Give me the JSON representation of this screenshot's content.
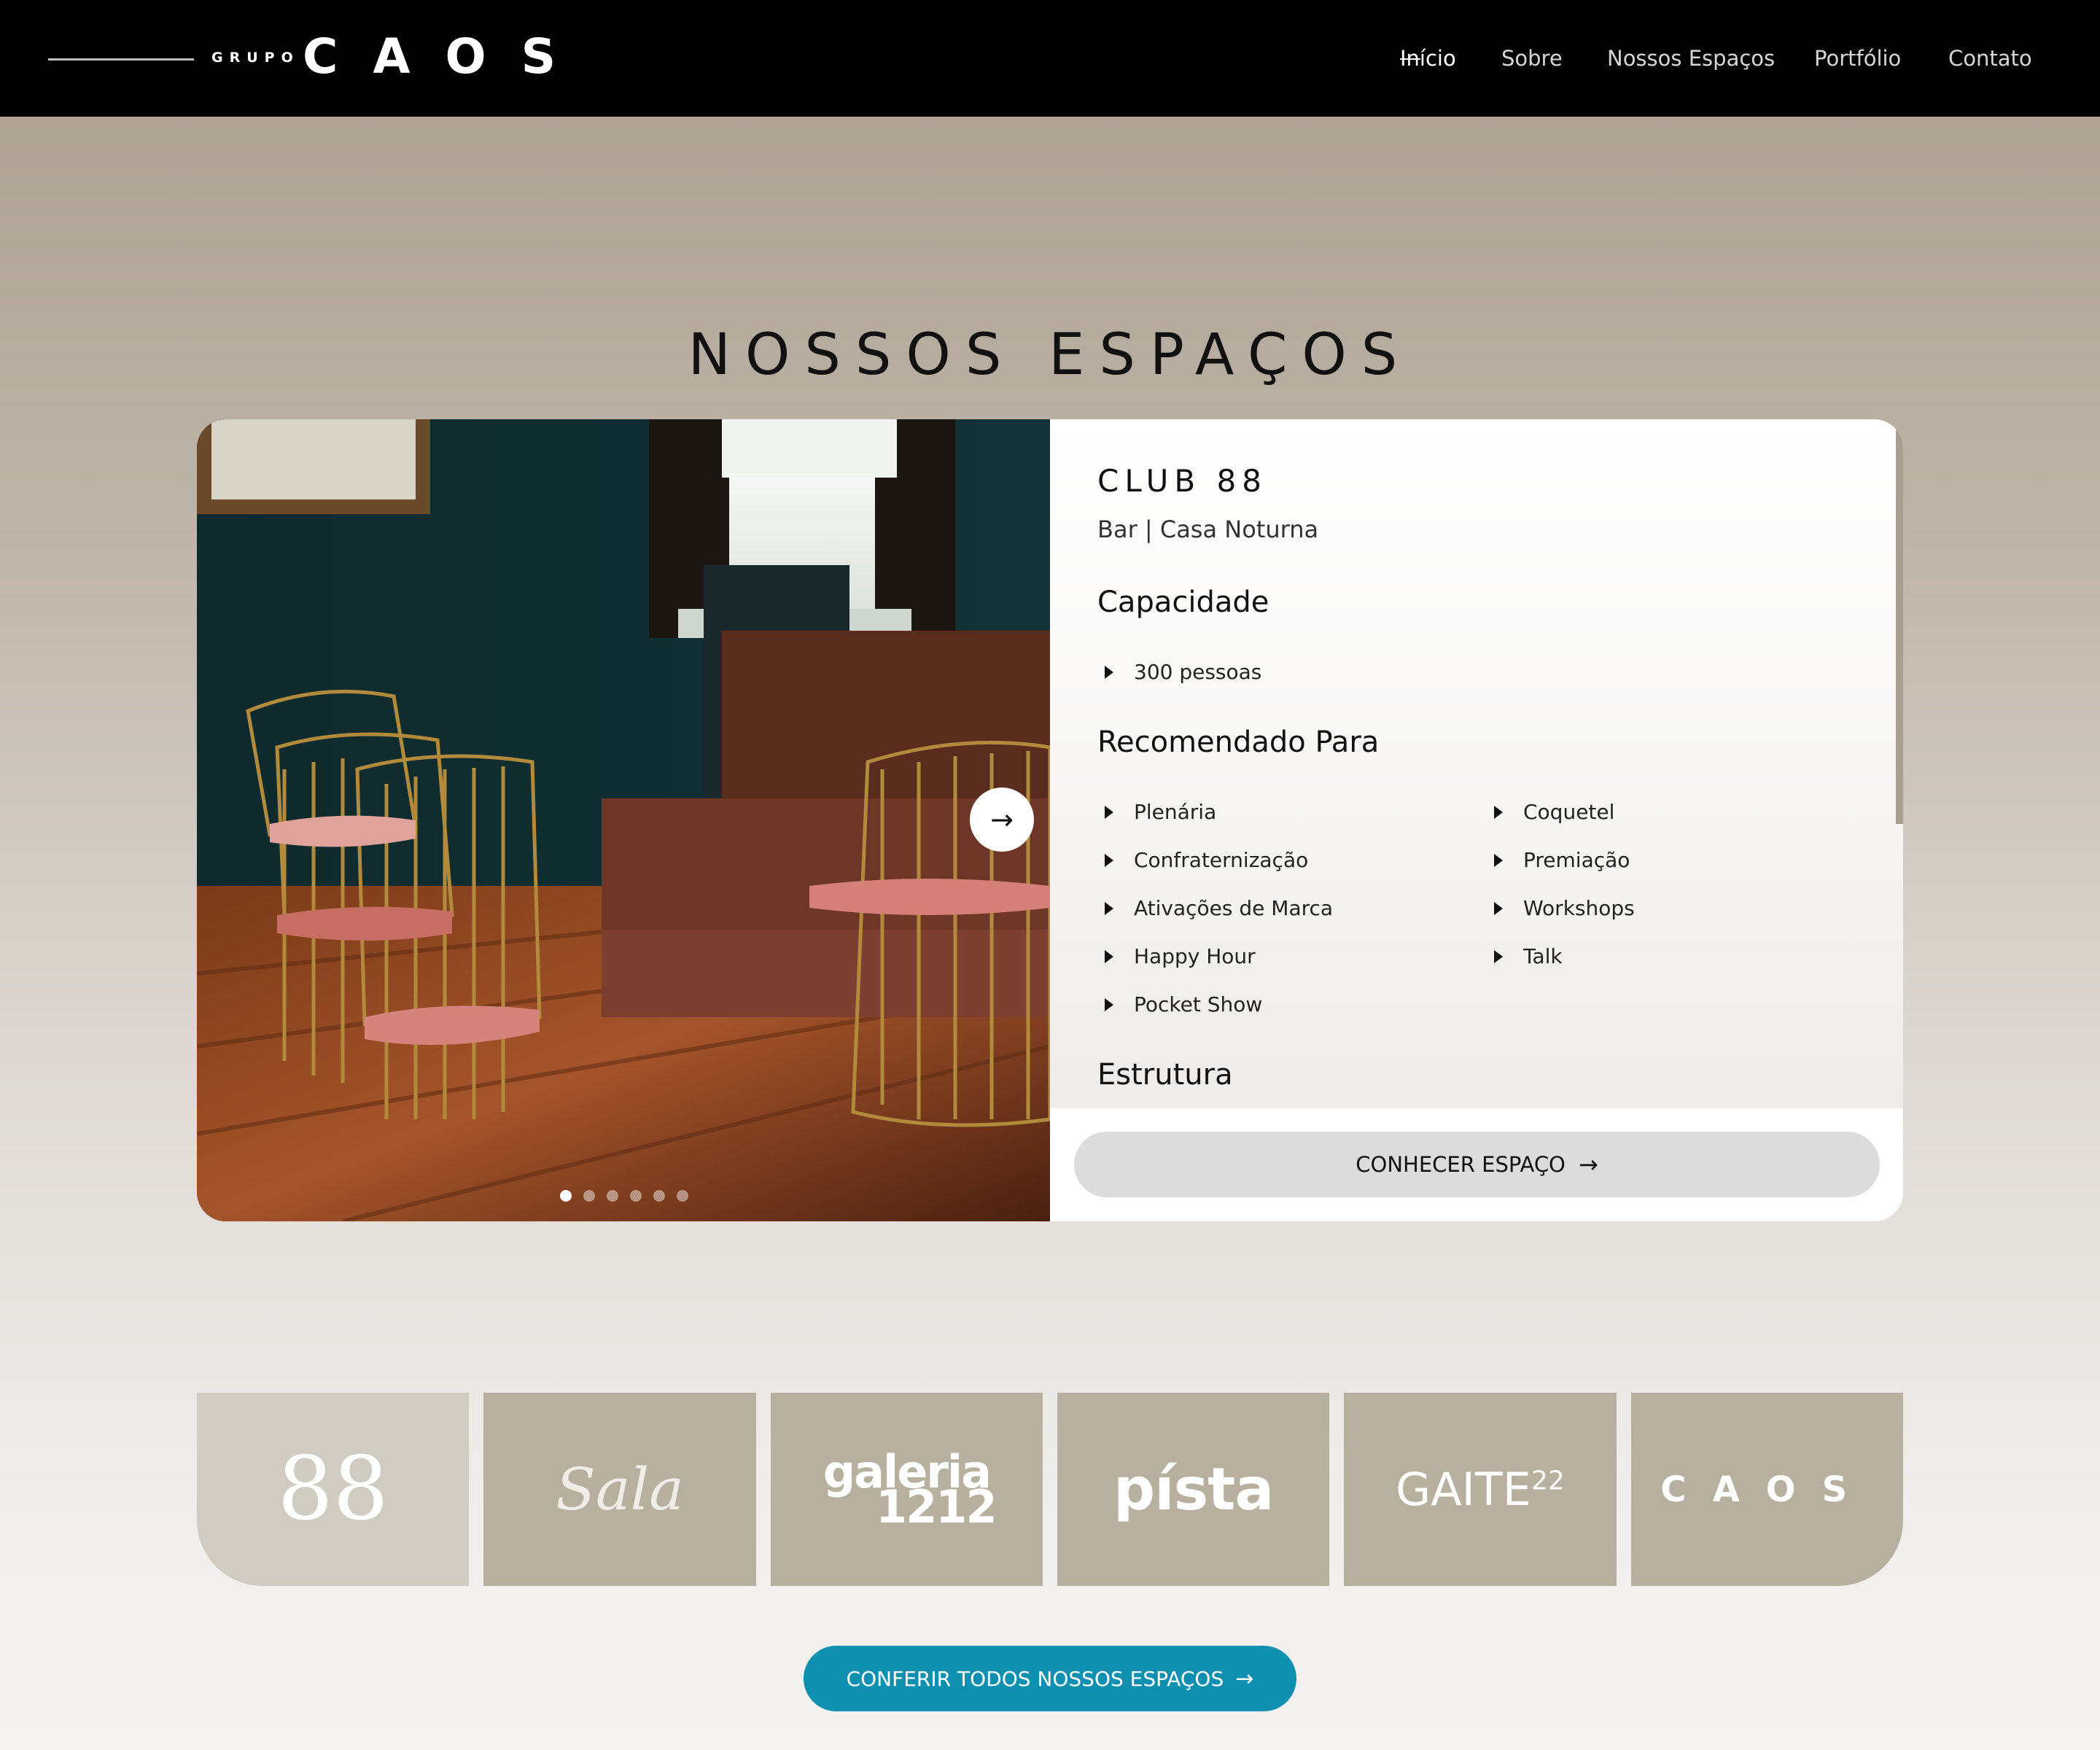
{
  "header": {
    "logo_prefix": "GRUPO",
    "logo_name": "CAOS",
    "nav": [
      {
        "label": "Início",
        "active": true
      },
      {
        "label": "Sobre",
        "active": false
      },
      {
        "label": "Nossos Espaços",
        "active": false
      },
      {
        "label": "Portfólio",
        "active": false
      },
      {
        "label": "Contato",
        "active": false
      }
    ]
  },
  "section_title": "NOSSOS ESPAÇOS",
  "venue": {
    "name": "CLUB 88",
    "type": "Bar | Casa Noturna",
    "capacity_heading": "Capacidade",
    "capacity": "300 pessoas",
    "recommended_heading": "Recomendado Para",
    "recommended_col1": [
      "Plenária",
      "Confraternização",
      "Ativações de Marca",
      "Happy Hour",
      "Pocket Show"
    ],
    "recommended_col2": [
      "Coquetel",
      "Premiação",
      "Workshops",
      "Talk"
    ],
    "structure_heading": "Estrutura",
    "cta_label": "CONHECER ESPAÇO",
    "slide_count": 6,
    "active_slide": 1
  },
  "tiles": [
    {
      "label": "88",
      "selected": true
    },
    {
      "label": "Sala",
      "selected": false
    },
    {
      "label": "galeria 1212",
      "line1": "galeria",
      "line2": "1212",
      "selected": false
    },
    {
      "label": "pista",
      "display": "písta",
      "selected": false
    },
    {
      "label": "GAITE22",
      "main": "GAITE",
      "sup": "22",
      "selected": false
    },
    {
      "label": "CAOS",
      "selected": false
    }
  ],
  "all_spaces_label": "CONFERIR TODOS NOSSOS ESPAÇOS",
  "colors": {
    "topbar": "#000000",
    "accent_button": "#0f90b1",
    "tile": "#b7b09f",
    "tile_selected": "#d1ccc2",
    "cta_button": "#dcdcdc"
  },
  "icons": {
    "arrow": "arrow-right-icon",
    "bullet": "triangle-bullet-icon"
  }
}
